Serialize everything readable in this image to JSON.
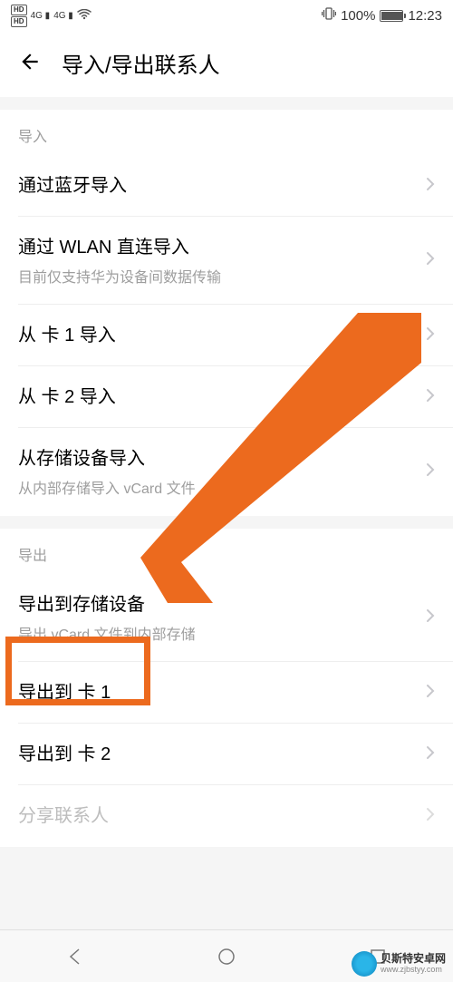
{
  "statusBar": {
    "hd1": "HD 1",
    "hd2": "HD 2",
    "signal1": "4G",
    "signal2": "4G",
    "vibrate": "vibrate",
    "battery": "100%",
    "time": "12:23"
  },
  "header": {
    "title": "导入/导出联系人"
  },
  "sections": {
    "import": {
      "header": "导入",
      "items": [
        {
          "title": "通过蓝牙导入",
          "subtitle": ""
        },
        {
          "title": "通过 WLAN 直连导入",
          "subtitle": "目前仅支持华为设备间数据传输"
        },
        {
          "title": "从 卡 1 导入",
          "subtitle": ""
        },
        {
          "title": "从 卡 2 导入",
          "subtitle": ""
        },
        {
          "title": "从存储设备导入",
          "subtitle": "从内部存储导入 vCard 文件"
        }
      ]
    },
    "export": {
      "header": "导出",
      "items": [
        {
          "title": "导出到存储设备",
          "subtitle": "导出 vCard 文件到内部存储"
        },
        {
          "title": "导出到 卡 1",
          "subtitle": ""
        },
        {
          "title": "导出到 卡 2",
          "subtitle": ""
        },
        {
          "title": "分享联系人",
          "subtitle": "",
          "disabled": true
        }
      ]
    }
  },
  "annotation": {
    "highlightTarget": "导出到 卡 1",
    "color": "#ec6a1e"
  },
  "watermark": {
    "title": "贝斯特安卓网",
    "url": "www.zjbstyy.com"
  }
}
